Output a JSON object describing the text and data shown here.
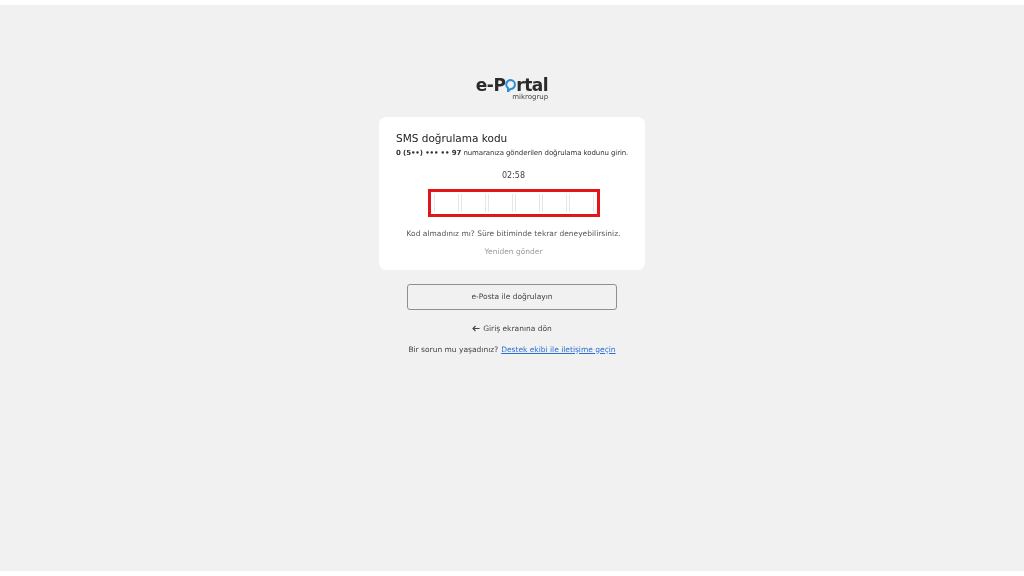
{
  "logo": {
    "before": "e-P",
    "after": "rtal",
    "subtitle": "mikrogrup"
  },
  "card": {
    "title": "SMS doğrulama kodu",
    "message": "**0 (5••) ••• •• 97** numaranıza gönderilen doğrulama kodunu girin.",
    "timer": "02:58",
    "code_input": {
      "highlighted": true,
      "digits": [
        {
          "filled": false
        },
        {
          "filled": false
        },
        {
          "filled": false
        },
        {
          "filled": false
        },
        {
          "filled": false
        },
        {
          "filled": false
        }
      ]
    },
    "hint": "Kod almadınız mı? Süre bitiminde tekrar deneyebilirsiniz.",
    "resend": {
      "label": "Yeniden gönder",
      "disabled": true
    }
  },
  "email_button": "e-Posta ile doğrulayın",
  "back_link": "Giriş ekranına dön",
  "support": {
    "text": "Bir sorun mu yaşadınız?",
    "link": "Destek ekibi ile iletişime geçin"
  }
}
